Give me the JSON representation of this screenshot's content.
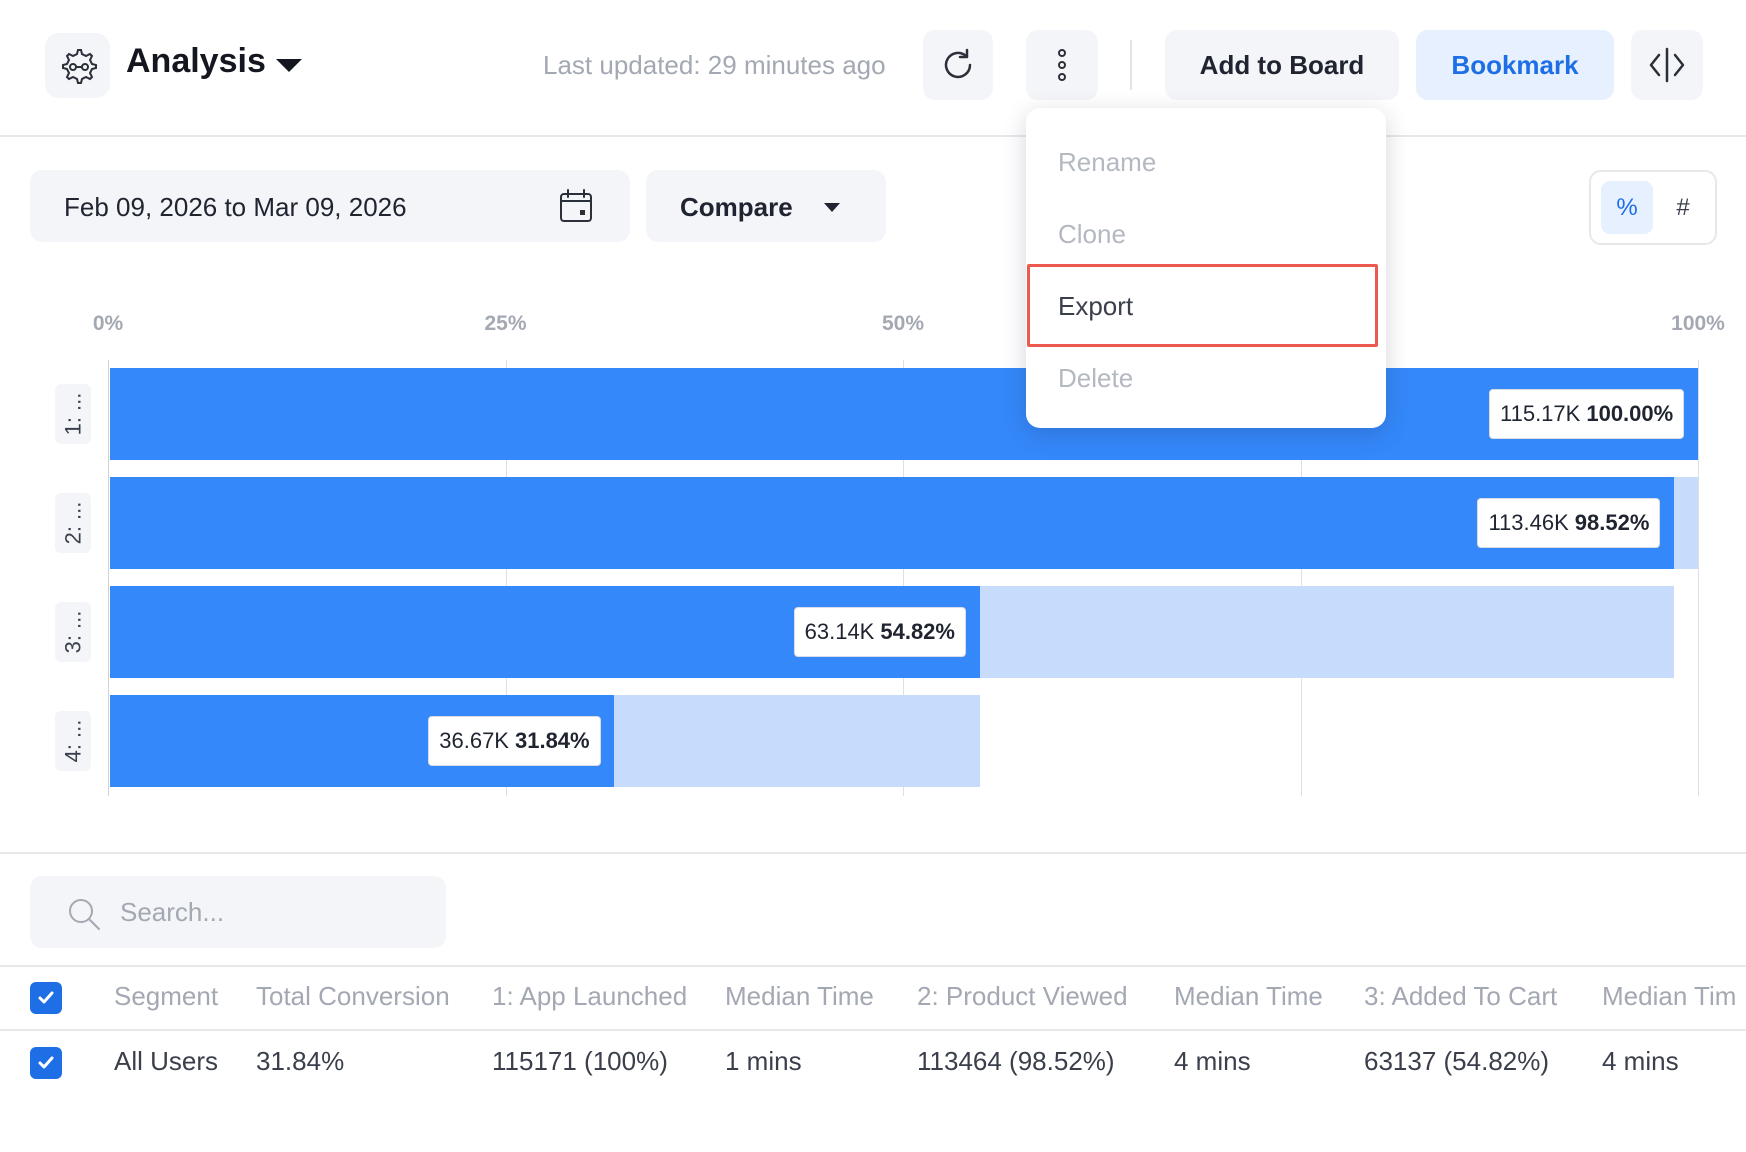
{
  "header": {
    "title": "Analysis",
    "last_updated": "Last updated: 29 minutes ago",
    "add_to_board_label": "Add to Board",
    "bookmark_label": "Bookmark",
    "icons": [
      "gear-flow-icon",
      "chevron-down-icon",
      "refresh-icon",
      "more-vertical-icon",
      "code-toggle-icon"
    ]
  },
  "controls": {
    "date_range": "Feb 09, 2026 to Mar 09, 2026",
    "compare_label": "Compare",
    "toggle_percent": "%",
    "toggle_count": "#",
    "active_toggle": "%"
  },
  "menu": {
    "items": [
      "Rename",
      "Clone",
      "Export",
      "Delete"
    ],
    "highlighted": "Export"
  },
  "chart_data": {
    "type": "bar",
    "orientation": "horizontal",
    "x_ticks": [
      "0%",
      "25%",
      "50%",
      "100%"
    ],
    "xlim": [
      0,
      100
    ],
    "categories": [
      "1: ...",
      "2: ...",
      "3: ...",
      "4: ..."
    ],
    "values": [
      100.0,
      98.52,
      54.82,
      31.84
    ],
    "previous_step_values": [
      100.0,
      100.0,
      98.52,
      54.82
    ],
    "counts": [
      "115.17K",
      "113.46K",
      "63.14K",
      "36.67K"
    ],
    "percent_labels": [
      "100.00%",
      "98.52%",
      "54.82%",
      "31.84%"
    ],
    "colors": {
      "bar": "#3588fa",
      "dropoff": "#c7dcfc"
    }
  },
  "search": {
    "placeholder": "Search..."
  },
  "table": {
    "headers": [
      "Segment",
      "Total Conversion",
      "1: App Launched",
      "Median Time",
      "2: Product Viewed",
      "Median Time",
      "3: Added To Cart",
      "Median Tim"
    ],
    "rows": [
      [
        "All Users",
        "31.84%",
        "115171 (100%)",
        "1 mins",
        "113464 (98.52%)",
        "4 mins",
        "63137 (54.82%)",
        "4 mins"
      ]
    ]
  },
  "colors": {
    "accent": "#1e6fe6",
    "highlight_outline": "#ec5a4f"
  }
}
